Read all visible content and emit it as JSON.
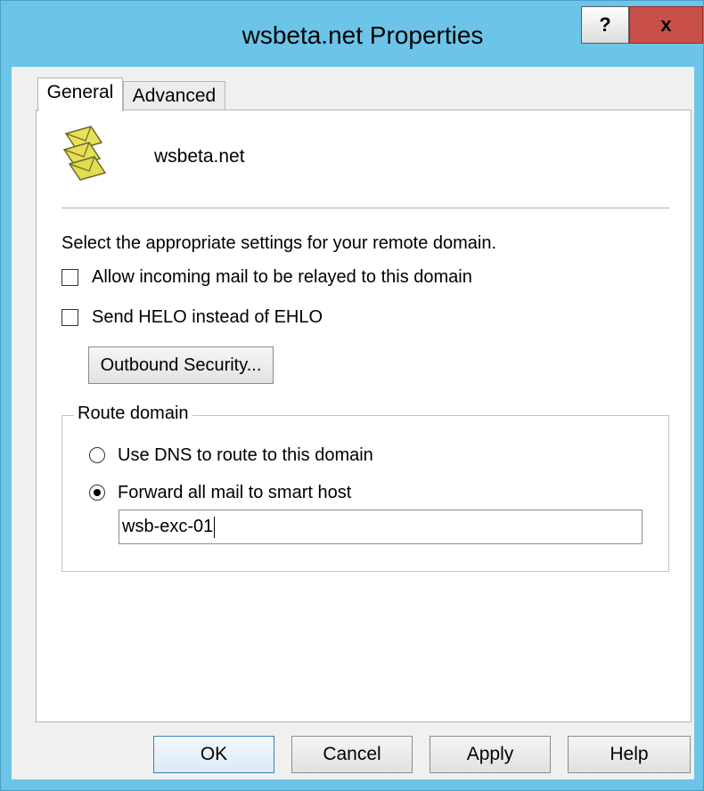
{
  "window": {
    "title": "wsbeta.net Properties",
    "help_glyph": "?",
    "close_glyph": "x"
  },
  "tabs": [
    {
      "label": "General",
      "selected": true
    },
    {
      "label": "Advanced",
      "selected": false
    }
  ],
  "general": {
    "domain_icon": "domain-envelopes-icon",
    "domain_name": "wsbeta.net",
    "instructions": "Select the appropriate settings for your remote domain.",
    "checkboxes": [
      {
        "label": "Allow incoming mail to be relayed to this domain",
        "checked": false
      },
      {
        "label": "Send HELO instead of EHLO",
        "checked": false
      }
    ],
    "outbound_security_label": "Outbound Security...",
    "route_domain": {
      "legend": "Route domain",
      "options": [
        {
          "label": "Use DNS to route to this domain",
          "selected": false
        },
        {
          "label": "Forward all mail to smart host",
          "selected": true
        }
      ],
      "smart_host_value": "wsb-exc-01"
    }
  },
  "buttons": {
    "ok": "OK",
    "cancel": "Cancel",
    "apply": "Apply",
    "help": "Help"
  },
  "colors": {
    "frame": "#6cc4e8",
    "close_button": "#c9504a",
    "default_button_border": "#3c7fb1"
  }
}
